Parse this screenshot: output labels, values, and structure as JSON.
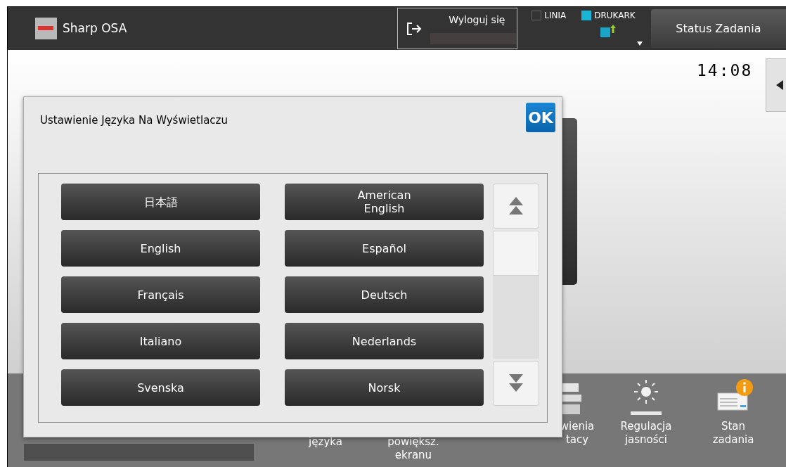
{
  "header": {
    "app_title": "Sharp OSA",
    "logout": {
      "label": "Wyloguj się"
    },
    "indicators": [
      {
        "label": "LINIA",
        "checked": false
      },
      {
        "label": "DRUKARK",
        "checked": true
      }
    ],
    "job_status_button": "Status Zadania"
  },
  "clock": "14:08",
  "dock": [
    {
      "label": "języka",
      "kind": "plain"
    },
    {
      "label": "powiększ.\nekranu",
      "kind": "plain"
    },
    {
      "label": "wienia\ntacy",
      "kind": "tray"
    },
    {
      "label": "Regulacja\njasności",
      "kind": "brightness"
    },
    {
      "label": "Stan\nzadania",
      "kind": "jobs"
    }
  ],
  "dialog": {
    "title": "Ustawienie Języka Na Wyświetlaczu",
    "ok": "OK",
    "languages": [
      "日本語",
      "American\nEnglish",
      "English",
      "Español",
      "Français",
      "Deutsch",
      "Italiano",
      "Nederlands",
      "Svenska",
      "Norsk"
    ]
  }
}
